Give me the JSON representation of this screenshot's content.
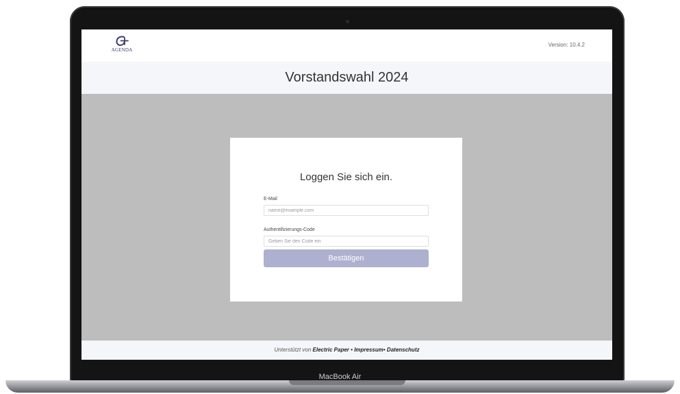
{
  "device": {
    "model_label": "MacBook Air"
  },
  "header": {
    "logo_text": "AGENDA",
    "version": "Version: 10.4.2"
  },
  "page": {
    "title": "Vorstandswahl 2024"
  },
  "login": {
    "heading": "Loggen Sie sich ein.",
    "email_label": "E-Mail",
    "email_placeholder": "name@example.com",
    "email_value": "",
    "code_label": "Authentifizierungs-Code",
    "code_placeholder": "Geben Sie den Code ein",
    "code_value": "",
    "submit_label": "Bestätigen"
  },
  "footer": {
    "prefix": "Unterstützt von ",
    "brand": "Electric Paper",
    "separator": "•",
    "impressum": "Impressum",
    "datenschutz": "Datenschutz"
  },
  "colors": {
    "button": "#aeb0d0",
    "content_background": "#bdbdbd",
    "title_band": "#f5f6fa"
  },
  "icons": {
    "logo": "agenda-logo-icon",
    "camera": "camera-icon"
  }
}
